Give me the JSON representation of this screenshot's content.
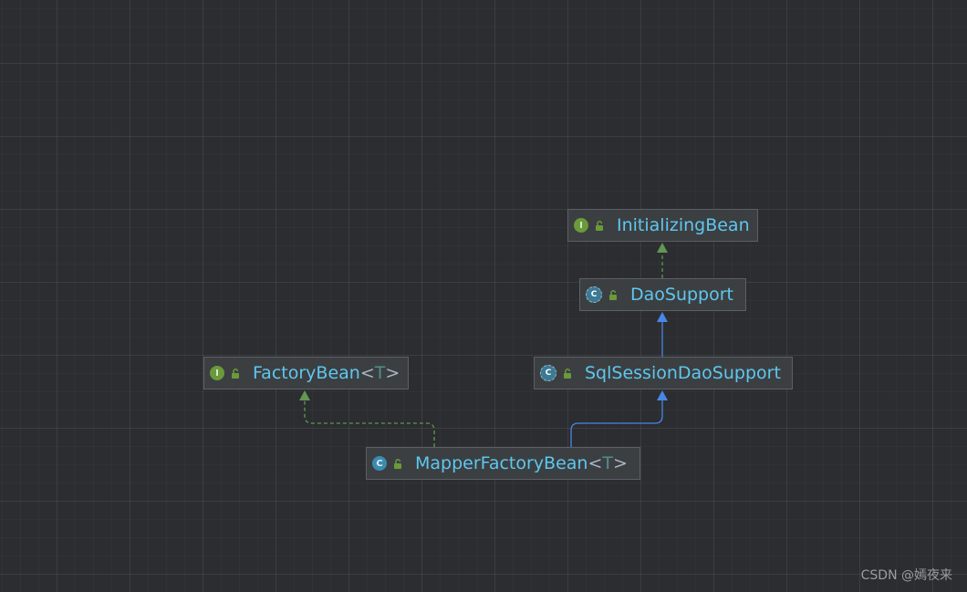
{
  "diagram": {
    "nodes": [
      {
        "id": "initializing-bean",
        "kind": "interface",
        "kind_glyph": "I",
        "name": "InitializingBean",
        "type_param": ""
      },
      {
        "id": "dao-support",
        "kind": "abstract-class",
        "kind_glyph": "C",
        "name": "DaoSupport",
        "type_param": ""
      },
      {
        "id": "factory-bean",
        "kind": "interface",
        "kind_glyph": "I",
        "name": "FactoryBean",
        "type_param": "T"
      },
      {
        "id": "sql-session-dao-support",
        "kind": "abstract-class",
        "kind_glyph": "C",
        "name": "SqlSessionDaoSupport",
        "type_param": ""
      },
      {
        "id": "mapper-factory-bean",
        "kind": "class",
        "kind_glyph": "C",
        "name": "MapperFactoryBean",
        "type_param": "T"
      }
    ],
    "edges": [
      {
        "from": "dao-support",
        "to": "initializing-bean",
        "relation": "implements"
      },
      {
        "from": "sql-session-dao-support",
        "to": "dao-support",
        "relation": "extends"
      },
      {
        "from": "mapper-factory-bean",
        "to": "sql-session-dao-support",
        "relation": "extends"
      },
      {
        "from": "mapper-factory-bean",
        "to": "factory-bean",
        "relation": "implements"
      }
    ]
  },
  "colors": {
    "background": "#2b2d30",
    "node_fill": "#3c3f41",
    "node_border": "#5c5f66",
    "class_name": "#5ec7f0",
    "type_param": "#4f8f8f",
    "extends_edge": "#4a86e8",
    "implements_edge": "#629755",
    "interface_icon": "#6a9a3a",
    "class_icon": "#3b8bb0",
    "lock_icon": "#6a9a3a"
  },
  "icons": {
    "interface": "interface-icon",
    "class": "class-icon",
    "abstract-class": "abstract-class-icon",
    "visibility": "unlocked-icon"
  },
  "watermark": "CSDN @嫣夜来"
}
